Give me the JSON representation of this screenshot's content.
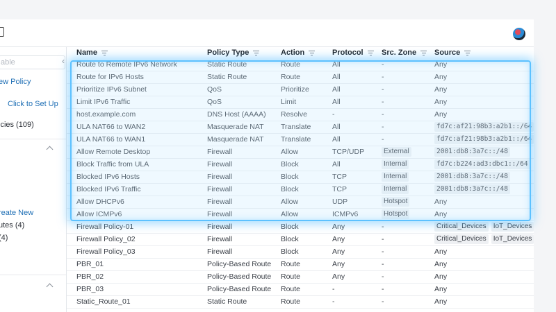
{
  "sidebar": {
    "search_placeholder": "able",
    "new_policy": "ew Policy",
    "setup_link": "Click to Set Up",
    "policies_count": "icies (109)",
    "create_new": "reate New",
    "routes": "utes (4)",
    "count4": "(4)"
  },
  "table": {
    "headers": {
      "name": "Name",
      "policy_type": "Policy Type",
      "action": "Action",
      "protocol": "Protocol",
      "src_zone": "Src. Zone",
      "source": "Source"
    },
    "rows": [
      {
        "name": "Route to Remote IPv6 Network",
        "type": "Static Route",
        "action": "Route",
        "protocol": "All",
        "zone": "-",
        "source": [
          "Any"
        ],
        "source_chip": false
      },
      {
        "name": "Route for IPv6 Hosts",
        "type": "Static Route",
        "action": "Route",
        "protocol": "All",
        "zone": "-",
        "source": [
          "Any"
        ],
        "source_chip": false
      },
      {
        "name": "Prioritize IPv6 Subnet",
        "type": "QoS",
        "action": "Prioritize",
        "protocol": "All",
        "zone": "-",
        "source": [
          "Any"
        ],
        "source_chip": false
      },
      {
        "name": "Limit IPv6 Traffic",
        "type": "QoS",
        "action": "Limit",
        "protocol": "All",
        "zone": "-",
        "source": [
          "Any"
        ],
        "source_chip": false
      },
      {
        "name": "host.example.com",
        "type": "DNS Host (AAAA)",
        "action": "Resolve",
        "protocol": "-",
        "zone": "-",
        "source": [
          "Any"
        ],
        "source_chip": false
      },
      {
        "name": "ULA NAT66 to WAN2",
        "type": "Masquerade NAT",
        "action": "Translate",
        "protocol": "All",
        "zone": "-",
        "source": [
          "fd7c:af21:98b3:a2b1::/64"
        ],
        "source_chip": true
      },
      {
        "name": "ULA NAT66 to WAN1",
        "type": "Masquerade NAT",
        "action": "Translate",
        "protocol": "All",
        "zone": "-",
        "source": [
          "fd7c:af21:98b3:a2b1::/64"
        ],
        "source_chip": true
      },
      {
        "name": "Allow Remote Desktop",
        "type": "Firewall",
        "action": "Allow",
        "protocol": "TCP/UDP",
        "zone": "External",
        "source": [
          "2001:db8:3a7c::/48"
        ],
        "source_chip": true
      },
      {
        "name": "Block Traffic from ULA",
        "type": "Firewall",
        "action": "Block",
        "protocol": "All",
        "zone": "Internal",
        "source": [
          "fd7c:b224:ad3:dbc1::/64"
        ],
        "source_chip": true
      },
      {
        "name": "Blocked IPv6 Hosts",
        "type": "Firewall",
        "action": "Block",
        "protocol": "TCP",
        "zone": "Internal",
        "source": [
          "2001:db8:3a7c::/48"
        ],
        "source_chip": true
      },
      {
        "name": "Blocked IPv6 Traffic",
        "type": "Firewall",
        "action": "Block",
        "protocol": "TCP",
        "zone": "Internal",
        "source": [
          "2001:db8:3a7c::/48"
        ],
        "source_chip": true
      },
      {
        "name": "Allow DHCPv6",
        "type": "Firewall",
        "action": "Allow",
        "protocol": "UDP",
        "zone": "Hotspot",
        "source": [
          "Any"
        ],
        "source_chip": false
      },
      {
        "name": "Allow ICMPv6",
        "type": "Firewall",
        "action": "Allow",
        "protocol": "ICMPv6",
        "zone": "Hotspot",
        "source": [
          "Any"
        ],
        "source_chip": false
      },
      {
        "name": "Firewall Policy-01",
        "type": "Firewall",
        "action": "Block",
        "protocol": "Any",
        "zone": "-",
        "source": [
          "Critical_Devices",
          "IoT_Devices"
        ],
        "source_chip": true
      },
      {
        "name": "Firewall Policy_02",
        "type": "Firewall",
        "action": "Block",
        "protocol": "Any",
        "zone": "-",
        "source": [
          "Critical_Devices",
          "IoT_Devices"
        ],
        "source_chip": true
      },
      {
        "name": "Firewall Policy_03",
        "type": "Firewall",
        "action": "Block",
        "protocol": "Any",
        "zone": "-",
        "source": [
          "Any"
        ],
        "source_chip": false
      },
      {
        "name": "PBR_01",
        "type": "Policy-Based Route",
        "action": "Route",
        "protocol": "Any",
        "zone": "-",
        "source": [
          "Any"
        ],
        "source_chip": false
      },
      {
        "name": "PBR_02",
        "type": "Policy-Based Route",
        "action": "Route",
        "protocol": "Any",
        "zone": "-",
        "source": [
          "Any"
        ],
        "source_chip": false
      },
      {
        "name": "PBR_03",
        "type": "Policy-Based Route",
        "action": "Route",
        "protocol": "-",
        "zone": "-",
        "source": [
          "Any"
        ],
        "source_chip": false
      },
      {
        "name": "Static_Route_01",
        "type": "Static Route",
        "action": "Route",
        "protocol": "-",
        "zone": "-",
        "source": [
          "Any"
        ],
        "source_chip": false
      }
    ]
  }
}
